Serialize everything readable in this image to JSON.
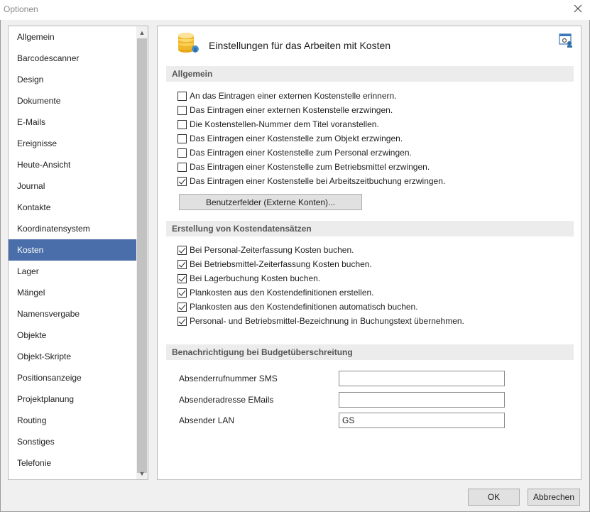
{
  "window": {
    "title": "Optionen",
    "close_icon": "close-icon"
  },
  "sidebar": {
    "items": [
      {
        "label": "Allgemein"
      },
      {
        "label": "Barcodescanner"
      },
      {
        "label": "Design"
      },
      {
        "label": "Dokumente"
      },
      {
        "label": "E-Mails"
      },
      {
        "label": "Ereignisse"
      },
      {
        "label": "Heute-Ansicht"
      },
      {
        "label": "Journal"
      },
      {
        "label": "Kontakte"
      },
      {
        "label": "Koordinatensystem"
      },
      {
        "label": "Kosten"
      },
      {
        "label": "Lager"
      },
      {
        "label": "Mängel"
      },
      {
        "label": "Namensvergabe"
      },
      {
        "label": "Objekte"
      },
      {
        "label": "Objekt-Skripte"
      },
      {
        "label": "Positionsanzeige"
      },
      {
        "label": "Projektplanung"
      },
      {
        "label": "Routing"
      },
      {
        "label": "Sonstiges"
      },
      {
        "label": "Telefonie"
      }
    ],
    "selected": "Kosten",
    "selected_color": "#4a6ea9"
  },
  "panel": {
    "title": "Einstellungen für das Arbeiten mit Kosten",
    "icon": "coins-icon",
    "corner_icon": "window-settings-icon"
  },
  "section_general": {
    "title": "Allgemein",
    "options": [
      {
        "label": "An das Eintragen einer externen Kostenstelle erinnern.",
        "checked": false
      },
      {
        "label": "Das Eintragen einer externen Kostenstelle erzwingen.",
        "checked": false
      },
      {
        "label": "Die Kostenstellen-Nummer dem Titel voranstellen.",
        "checked": false
      },
      {
        "label": "Das Eintragen einer Kostenstelle zum Objekt erzwingen.",
        "checked": false
      },
      {
        "label": "Das Eintragen einer Kostenstelle zum Personal erzwingen.",
        "checked": false
      },
      {
        "label": "Das Eintragen einer Kostenstelle zum Betriebsmittel erzwingen.",
        "checked": false
      },
      {
        "label": "Das Eintragen einer Kostenstelle bei Arbeitszeitbuchung erzwingen.",
        "checked": true
      }
    ],
    "user_fields_button": "Benutzerfelder (Externe Konten)..."
  },
  "section_creation": {
    "title": "Erstellung von Kostendatensätzen",
    "options": [
      {
        "label": "Bei Personal-Zeiterfassung Kosten buchen.",
        "checked": true
      },
      {
        "label": "Bei Betriebsmittel-Zeiterfassung Kosten buchen.",
        "checked": true
      },
      {
        "label": "Bei Lagerbuchung Kosten buchen.",
        "checked": true
      },
      {
        "label": "Plankosten aus den Kostendefinitionen erstellen.",
        "checked": true
      },
      {
        "label": "Plankosten aus den Kostendefinitionen automatisch buchen.",
        "checked": true
      },
      {
        "label": "Personal- und Betriebsmittel-Bezeichnung in Buchungstext übernehmen.",
        "checked": true
      }
    ]
  },
  "section_budget": {
    "title": "Benachrichtigung bei Budgetüberschreitung",
    "fields": [
      {
        "label": "Absenderrufnummer SMS",
        "value": ""
      },
      {
        "label": "Absenderadresse EMails",
        "value": ""
      },
      {
        "label": "Absender LAN",
        "value": "GS"
      }
    ]
  },
  "footer": {
    "ok_label": "OK",
    "cancel_label": "Abbrechen"
  }
}
